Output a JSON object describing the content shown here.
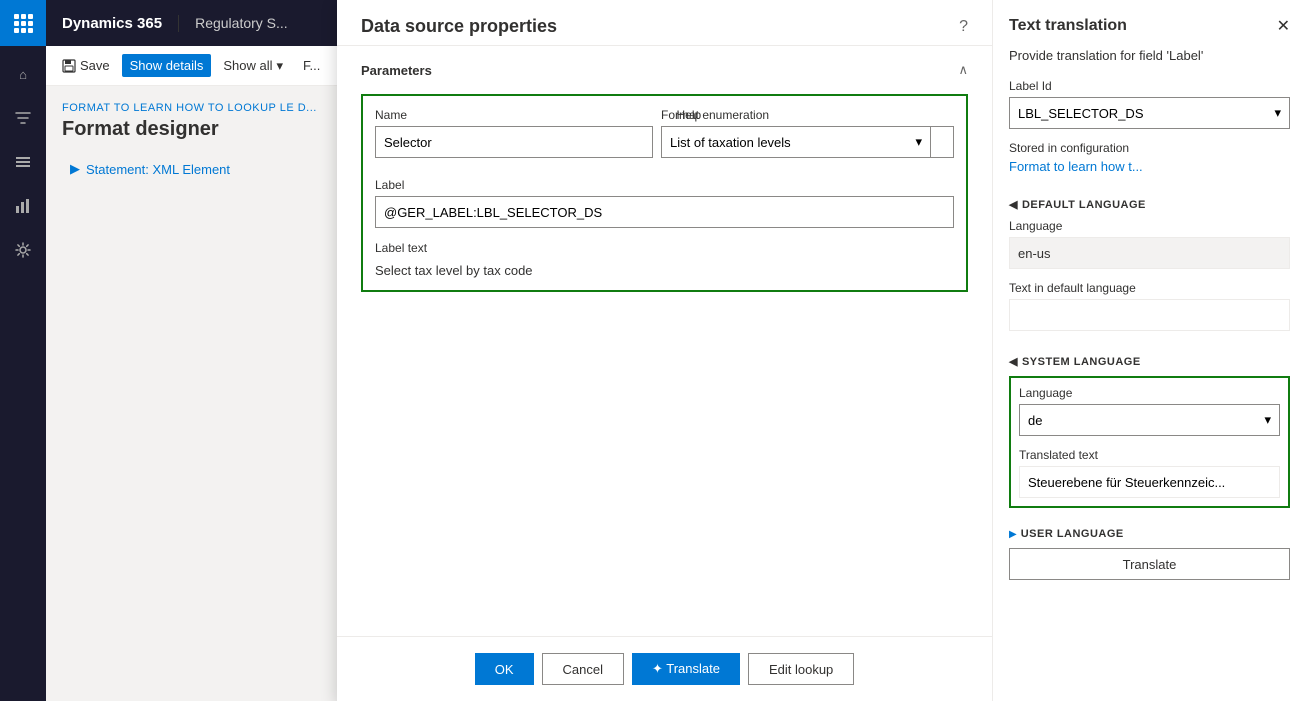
{
  "topbar": {
    "title": "Dynamics 365",
    "app_name": "Regulatory S..."
  },
  "sidebar": {
    "icons": [
      {
        "name": "home-icon",
        "symbol": "⌂"
      },
      {
        "name": "filter-icon",
        "symbol": "▽"
      },
      {
        "name": "list-icon",
        "symbol": "☰"
      },
      {
        "name": "chart-icon",
        "symbol": "◫"
      },
      {
        "name": "settings-icon",
        "symbol": "⚙"
      }
    ]
  },
  "toolbar": {
    "save_label": "Save",
    "show_details_label": "Show details",
    "show_all_label": "Show all",
    "format_label": "F..."
  },
  "breadcrumb": "FORMAT TO LEARN HOW TO LOOKUP LE D...",
  "page_title": "Format designer",
  "tree": {
    "item": "Statement: XML Element"
  },
  "modal": {
    "title": "Data source properties",
    "help_icon": "?",
    "sections": {
      "parameters": {
        "title": "Parameters",
        "name_label": "Name",
        "name_value": "Selector",
        "help_label": "Help",
        "help_value": "",
        "label_label": "Label",
        "label_value": "@GER_LABEL:LBL_SELECTOR_DS",
        "format_enum_label": "Format enumeration",
        "format_enum_value": "List of taxation levels",
        "label_text_label": "Label text",
        "label_text_value": "Select tax level by tax code"
      }
    },
    "footer": {
      "ok_label": "OK",
      "cancel_label": "Cancel",
      "translate_label": "Translate",
      "edit_lookup_label": "Edit lookup"
    }
  },
  "translation_panel": {
    "title": "Text translation",
    "close_icon": "✕",
    "subtitle": "Provide translation for field 'Label'",
    "label_id_label": "Label Id",
    "label_id_value": "LBL_SELECTOR_DS",
    "stored_in_config_label": "Stored in configuration",
    "stored_in_config_value": "Format to learn how t...",
    "default_language_section": "DEFAULT LANGUAGE",
    "language_label": "Language",
    "language_value": "en-us",
    "text_default_label": "Text in default language",
    "text_default_value": "",
    "system_language_section": "SYSTEM LANGUAGE",
    "system_lang_label": "Language",
    "system_lang_value": "de",
    "translated_text_label": "Translated text",
    "translated_text_value": "Steuerebene für Steuerkennzeic...",
    "user_language_section": "USER LANGUAGE",
    "translate_btn_label": "Translate"
  }
}
